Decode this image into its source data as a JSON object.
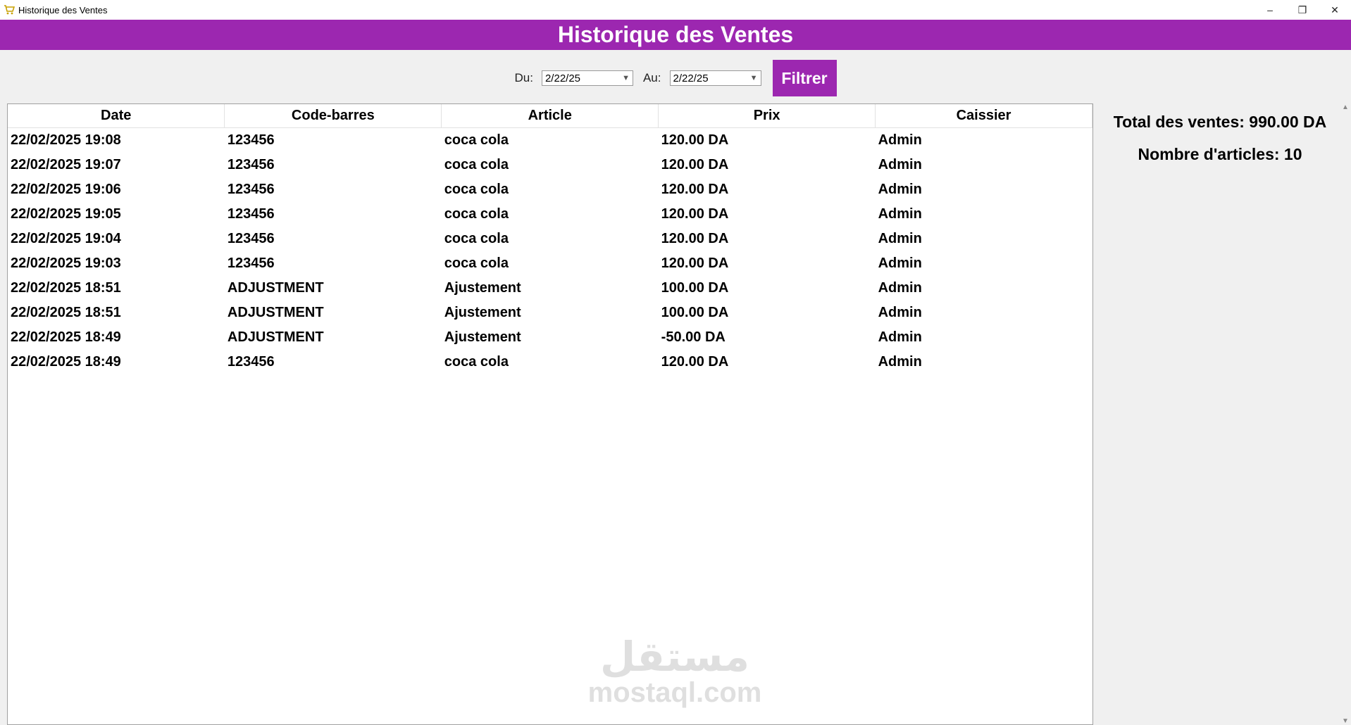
{
  "window": {
    "title": "Historique des Ventes",
    "minimize": "–",
    "restore": "❐",
    "close": "✕"
  },
  "header": {
    "title": "Historique des Ventes"
  },
  "filter": {
    "from_label": "Du:",
    "from_value": "2/22/25",
    "to_label": "Au:",
    "to_value": "2/22/25",
    "button_label": "Filtrer"
  },
  "table": {
    "columns": [
      "Date",
      "Code-barres",
      "Article",
      "Prix",
      "Caissier"
    ],
    "rows": [
      [
        "22/02/2025 19:08",
        "123456",
        "coca cola",
        "120.00 DA",
        "Admin"
      ],
      [
        "22/02/2025 19:07",
        "123456",
        "coca cola",
        "120.00 DA",
        "Admin"
      ],
      [
        "22/02/2025 19:06",
        "123456",
        "coca cola",
        "120.00 DA",
        "Admin"
      ],
      [
        "22/02/2025 19:05",
        "123456",
        "coca cola",
        "120.00 DA",
        "Admin"
      ],
      [
        "22/02/2025 19:04",
        "123456",
        "coca cola",
        "120.00 DA",
        "Admin"
      ],
      [
        "22/02/2025 19:03",
        "123456",
        "coca cola",
        "120.00 DA",
        "Admin"
      ],
      [
        "22/02/2025 18:51",
        "ADJUSTMENT",
        "Ajustement",
        "100.00 DA",
        "Admin"
      ],
      [
        "22/02/2025 18:51",
        "ADJUSTMENT",
        "Ajustement",
        "100.00 DA",
        "Admin"
      ],
      [
        "22/02/2025 18:49",
        "ADJUSTMENT",
        "Ajustement",
        "-50.00 DA",
        "Admin"
      ],
      [
        "22/02/2025 18:49",
        "123456",
        "coca cola",
        "120.00 DA",
        "Admin"
      ]
    ]
  },
  "summary": {
    "total": "Total des ventes: 990.00 DA",
    "count": "Nombre d'articles: 10"
  },
  "watermark": {
    "arabic": "مستقل",
    "latin": "mostaql.com"
  },
  "colors": {
    "accent": "#9c27b0"
  },
  "icons": {
    "app": "cart-icon",
    "dropdown": "chevron-down-icon"
  }
}
